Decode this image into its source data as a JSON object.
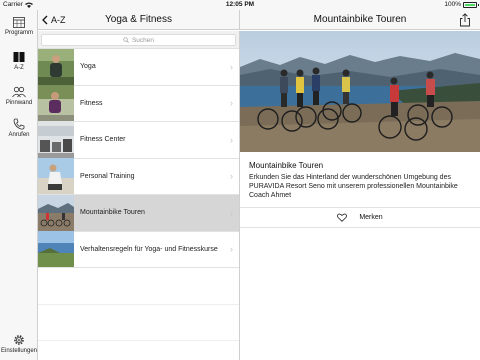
{
  "status_bar": {
    "carrier": "Carrier",
    "time": "12:05 PM",
    "battery": "100%",
    "battery_level": 1.0
  },
  "tab_bar": {
    "items": [
      {
        "label": "Programm",
        "icon": "calendar-icon"
      },
      {
        "label": "A-Z",
        "icon": "book-icon",
        "active": true
      },
      {
        "label": "Pinnwand",
        "icon": "people-icon"
      },
      {
        "label": "Anrufen",
        "icon": "phone-icon"
      },
      {
        "label": "Einstellungen",
        "icon": "gear-icon"
      }
    ]
  },
  "master": {
    "back_label": "A-Z",
    "title": "Yoga & Fitness",
    "search_placeholder": "Suchen",
    "items": [
      {
        "label": "Yoga"
      },
      {
        "label": "Fitness"
      },
      {
        "label": "Fitness Center"
      },
      {
        "label": "Personal Training"
      },
      {
        "label": "Mountainbike Touren",
        "selected": true
      },
      {
        "label": "Verhaltensregeln für Yoga- und Fitnesskurse"
      }
    ]
  },
  "detail": {
    "title": "Mountainbike Touren",
    "heading": "Mountainbike Touren",
    "description": "Erkunden Sie das Hinterland der wunderschönen Umgebung des PURAVIDA Resort Seno mit unserem professionellen Mountainbike Coach Ahmet",
    "favorite_label": "Merken"
  },
  "colors": {
    "bar_background": "#f7f7f7",
    "selected_row": "#d6d6d6",
    "battery_green": "#4cd964"
  }
}
